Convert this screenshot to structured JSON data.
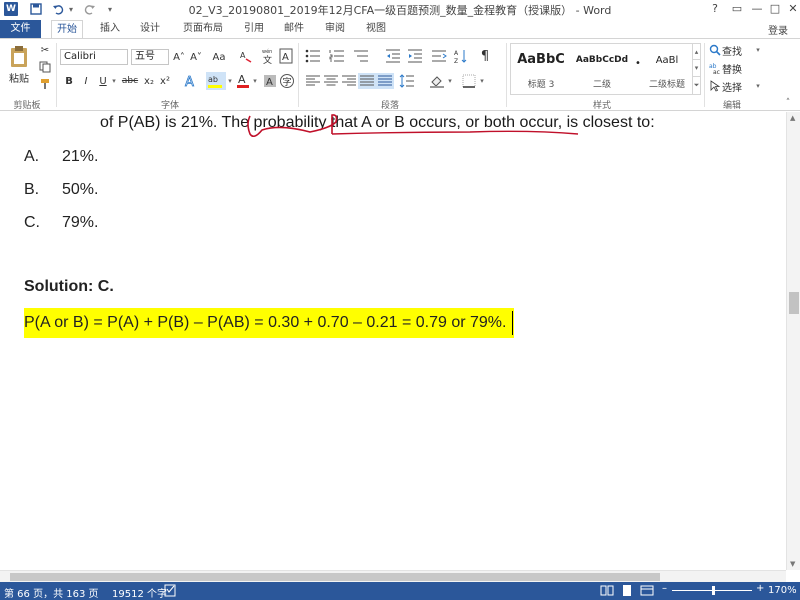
{
  "window": {
    "title": "02_V3_20190801_2019年12月CFA一级百题预测_数量_金程教育（授课版） - Word",
    "logo": "W",
    "help": "?",
    "restore": "▭",
    "minimize": "—",
    "maximize": "□",
    "close": "✕"
  },
  "quick_access": {
    "save_icon": "floppy-icon",
    "undo_icon": "undo-icon",
    "redo_icon": "redo-icon"
  },
  "tabs": {
    "file": "文件",
    "home": "开始",
    "insert": "插入",
    "design": "设计",
    "layout": "页面布局",
    "references": "引用",
    "mailings": "邮件",
    "review": "审阅",
    "view": "视图"
  },
  "account": {
    "login": "登录"
  },
  "ribbon": {
    "clipboard": {
      "paste": "粘贴",
      "label": "剪贴板"
    },
    "font": {
      "font_name": "Calibri",
      "font_size": "五号",
      "grow": "A˄",
      "shrink": "A˅",
      "case": "Aa",
      "bold": "B",
      "italic": "I",
      "underline": "U",
      "strike": "abc",
      "subscript": "x₂",
      "superscript": "x²",
      "label": "字体"
    },
    "paragraph": {
      "label": "段落"
    },
    "styles": {
      "items": [
        {
          "sample": "AaBbC",
          "name": "标题 3"
        },
        {
          "sample": "AaBbCcDd",
          "name": "二级"
        },
        {
          "sample": "AaBl",
          "name": "二级标题"
        }
      ],
      "label": "样式"
    },
    "editing": {
      "find": "查找",
      "replace": "替换",
      "select": "选择",
      "label": "编辑"
    }
  },
  "document": {
    "question_tail": "of P(AB) is 21%. The probability that A or B occurs, or both occur, is closest to:",
    "options": [
      {
        "letter": "A.",
        "text": "21%."
      },
      {
        "letter": "B.",
        "text": "50%."
      },
      {
        "letter": "C.",
        "text": "79%."
      }
    ],
    "solution_label": "Solution: C.",
    "formula": "P(A or B) = P(A) + P(B) – P(AB) = 0.30 + 0.70 – 0.21 = 0.79 or 79%."
  },
  "status": {
    "page": "第 66 页，共 163 页",
    "words": "19512 个字",
    "zoom": "170%"
  },
  "colors": {
    "brand": "#2b579a",
    "highlight": "#ffff00",
    "annotation": "#c0102a"
  }
}
